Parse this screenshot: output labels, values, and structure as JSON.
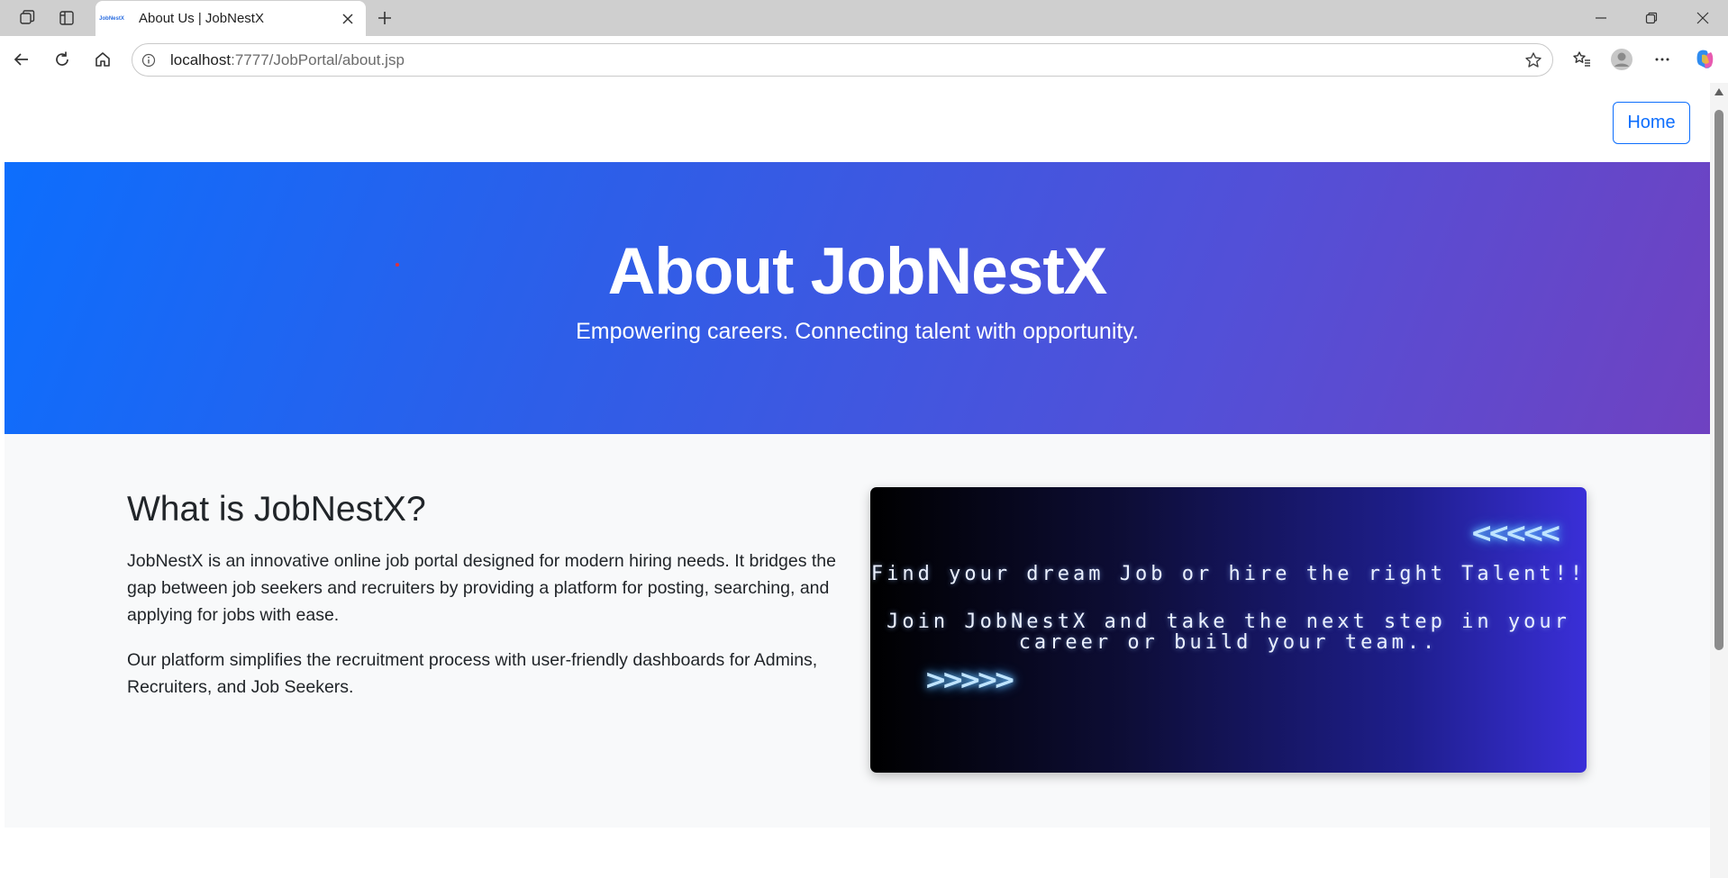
{
  "browser": {
    "tab_title": "About Us | JobNestX",
    "tab_favicon_text": "JobNestX",
    "url_host": "localhost",
    "url_rest": ":7777/JobPortal/about.jsp"
  },
  "header": {
    "home_label": "Home"
  },
  "hero": {
    "title": "About JobNestX",
    "subtitle": "Empowering careers. Connecting talent with opportunity."
  },
  "about": {
    "heading": "What is JobNestX?",
    "paragraph1": "JobNestX is an innovative online job portal designed for modern hiring needs. It bridges the gap between job seekers and recruiters by providing a platform for posting, searching, and applying for jobs with ease.",
    "paragraph2": "Our platform simplifies the recruitment process with user-friendly dashboards for Admins, Recruiters, and Job Seekers."
  },
  "promo": {
    "left_arrows": "<<<<<",
    "line1": "Find your dream Job or hire the right Talent!!",
    "line2": "Join JobNestX and take the next step in your",
    "line3": "career or build your team..",
    "right_arrows": ">>>>>"
  },
  "colors": {
    "primary": "#0d6efd",
    "hero_end": "#6f42c1",
    "section_bg": "#f8f9fa"
  }
}
